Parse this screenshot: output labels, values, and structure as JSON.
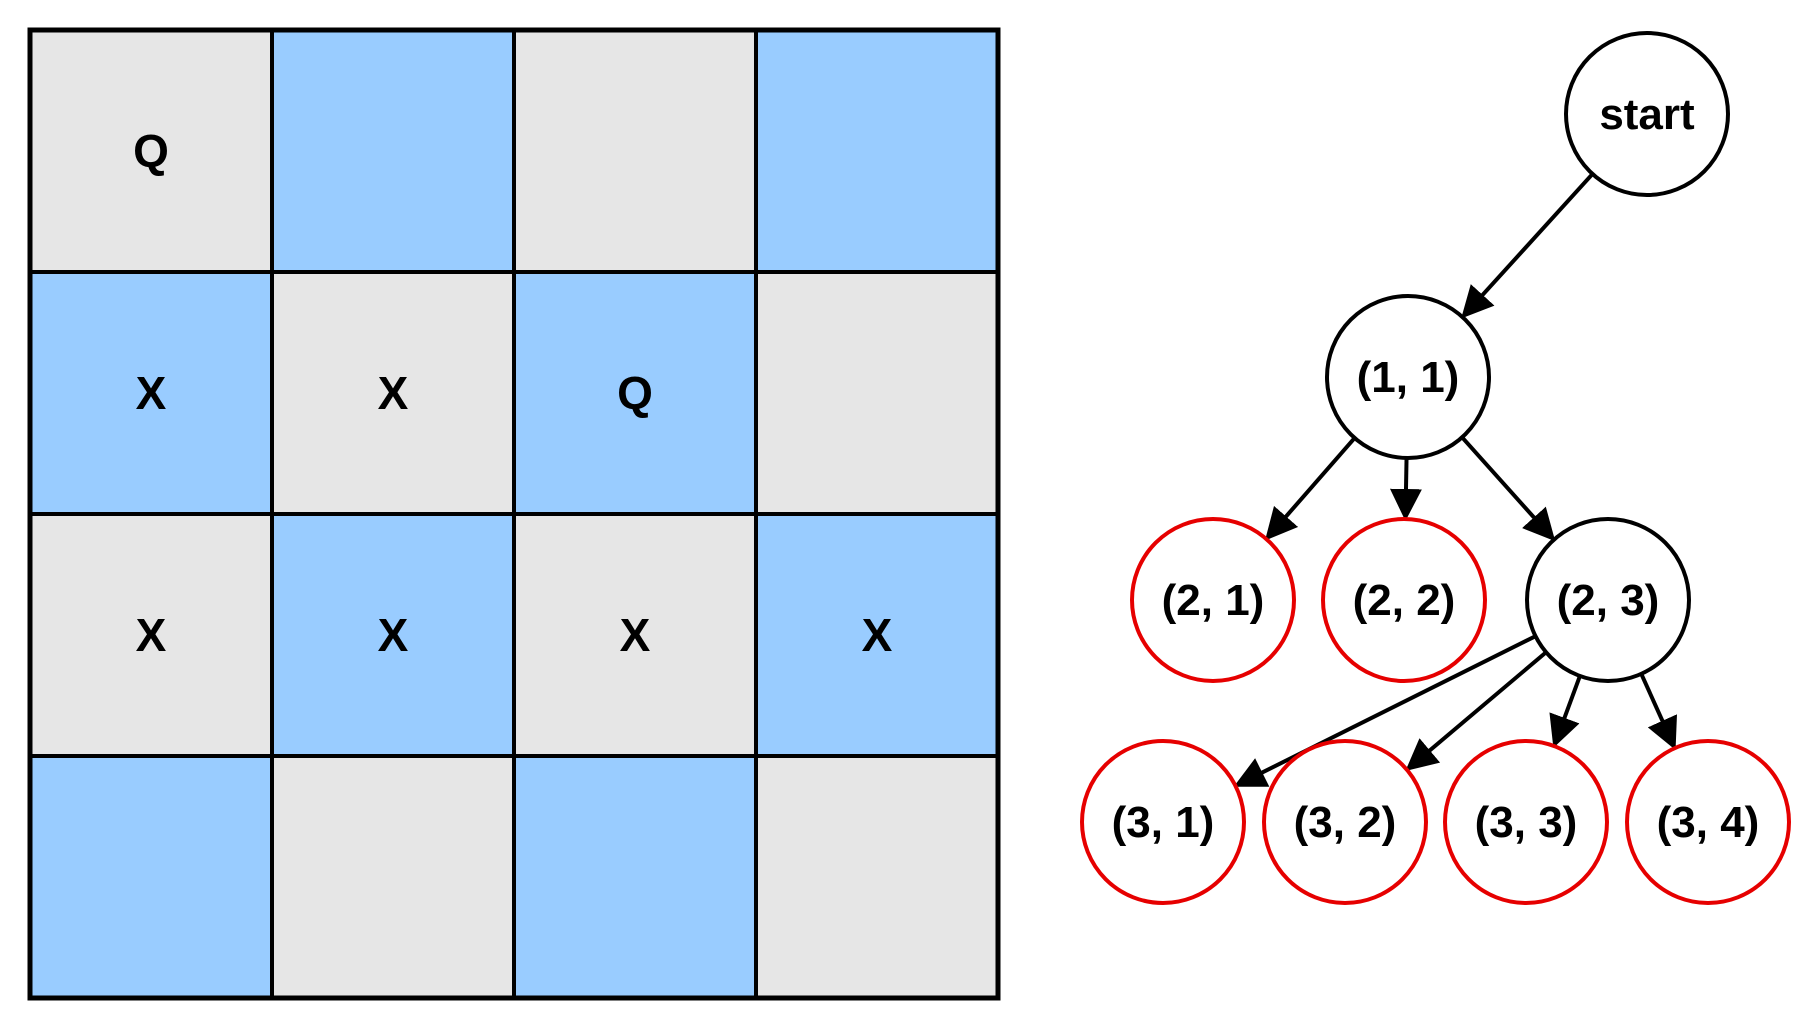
{
  "colors": {
    "cell_light": "#e6e6e6",
    "cell_blue": "#99ccff",
    "grid_line": "#000000",
    "node_normal": "#000000",
    "node_pruned": "#e60000",
    "edge": "#000000"
  },
  "board": {
    "rows": [
      [
        {
          "shade": "light",
          "mark": "Q"
        },
        {
          "shade": "blue",
          "mark": ""
        },
        {
          "shade": "light",
          "mark": ""
        },
        {
          "shade": "blue",
          "mark": ""
        }
      ],
      [
        {
          "shade": "blue",
          "mark": "X"
        },
        {
          "shade": "light",
          "mark": "X"
        },
        {
          "shade": "blue",
          "mark": "Q"
        },
        {
          "shade": "light",
          "mark": ""
        }
      ],
      [
        {
          "shade": "light",
          "mark": "X"
        },
        {
          "shade": "blue",
          "mark": "X"
        },
        {
          "shade": "light",
          "mark": "X"
        },
        {
          "shade": "blue",
          "mark": "X"
        }
      ],
      [
        {
          "shade": "blue",
          "mark": ""
        },
        {
          "shade": "light",
          "mark": ""
        },
        {
          "shade": "blue",
          "mark": ""
        },
        {
          "shade": "light",
          "mark": ""
        }
      ]
    ]
  },
  "tree": {
    "nodes": [
      {
        "id": "start",
        "label": "start",
        "status": "normal"
      },
      {
        "id": "n11",
        "label": "(1, 1)",
        "status": "normal"
      },
      {
        "id": "n21",
        "label": "(2, 1)",
        "status": "pruned"
      },
      {
        "id": "n22",
        "label": "(2, 2)",
        "status": "pruned"
      },
      {
        "id": "n23",
        "label": "(2, 3)",
        "status": "normal"
      },
      {
        "id": "n31",
        "label": "(3, 1)",
        "status": "pruned"
      },
      {
        "id": "n32",
        "label": "(3, 2)",
        "status": "pruned"
      },
      {
        "id": "n33",
        "label": "(3, 3)",
        "status": "pruned"
      },
      {
        "id": "n34",
        "label": "(3, 4)",
        "status": "pruned"
      }
    ],
    "edges": [
      {
        "from": "start",
        "to": "n11"
      },
      {
        "from": "n11",
        "to": "n21"
      },
      {
        "from": "n11",
        "to": "n22"
      },
      {
        "from": "n11",
        "to": "n23"
      },
      {
        "from": "n23",
        "to": "n31"
      },
      {
        "from": "n23",
        "to": "n32"
      },
      {
        "from": "n23",
        "to": "n33"
      },
      {
        "from": "n23",
        "to": "n34"
      }
    ]
  }
}
